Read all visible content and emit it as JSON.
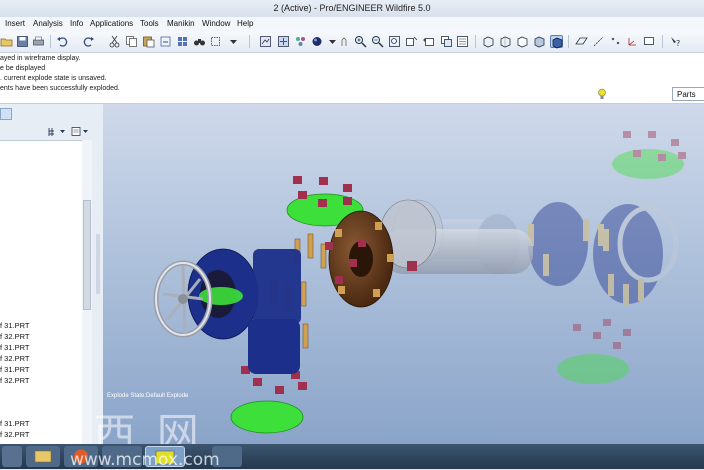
{
  "window": {
    "title": "2 (Active) - Pro/ENGINEER Wildfire 5.0"
  },
  "menu": [
    "Insert",
    "Analysis",
    "Info",
    "Applications",
    "Tools",
    "Manikin",
    "Window",
    "Help"
  ],
  "messages": [
    "ayed in wireframe display.",
    "e be displayed",
    ". current explode state is unsaved.",
    "ents have been successfully exploded."
  ],
  "filter": {
    "value": "Parts"
  },
  "tree": {
    "items": [
      "f 31.PRT",
      "f 32.PRT",
      "f 31.PRT",
      "f 32.PRT",
      "f 31.PRT",
      "f 32.PRT",
      "f 31.PRT",
      "f 32.PRT"
    ]
  },
  "viewport": {
    "state_label": "Explode State:Default Explode"
  },
  "watermark": {
    "text": "莫 西 网",
    "url": "www.mcmox.com"
  },
  "icons": {
    "toolbar": [
      "open-icon",
      "save-icon",
      "print-icon",
      "undo-icon",
      "redo-icon",
      "cut-icon",
      "copy-icon",
      "paste-icon",
      "regenerate-icon",
      "find-icon",
      "select-box-icon",
      "repaint-icon",
      "spin-center-icon",
      "orient-icon",
      "zoom-in-icon",
      "zoom-out-icon",
      "refit-icon",
      "view-manager-icon",
      "saved-views-icon",
      "wireframe-icon",
      "hidden-line-icon",
      "no-hidden-icon",
      "shaded-icon",
      "enhanced-icon",
      "datum-plane-icon",
      "datum-axis-icon",
      "datum-point-icon",
      "csys-icon",
      "whats-this-icon"
    ]
  },
  "colors": {
    "viewport_top": "#cfd9ea",
    "viewport_bottom": "#8aa4c9",
    "flange": "#6b3a1e",
    "bolt": "#d0a050",
    "nut": "#a0304e",
    "gasket": "#3de03a",
    "blue_part": "#1c2f8a"
  }
}
